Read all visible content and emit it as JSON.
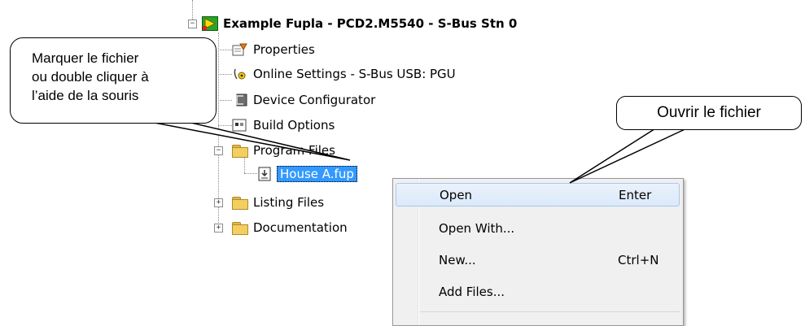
{
  "tree": {
    "root": "Example Fupla - PCD2.M5540 - S-Bus Stn 0",
    "items": [
      {
        "label": "Properties"
      },
      {
        "label": "Online Settings - S-Bus USB: PGU"
      },
      {
        "label": "Device Configurator"
      },
      {
        "label": "Build Options"
      },
      {
        "label": "Program Files"
      },
      {
        "label": "House A.fup"
      },
      {
        "label": "Listing Files"
      },
      {
        "label": "Documentation"
      }
    ]
  },
  "context_menu": {
    "items": [
      {
        "label": "Open",
        "shortcut": "Enter"
      },
      {
        "label": "Open With...",
        "shortcut": ""
      },
      {
        "label": "New...",
        "shortcut": "Ctrl+N"
      },
      {
        "label": "Add Files...",
        "shortcut": ""
      }
    ]
  },
  "callouts": {
    "left": [
      "Marquer le fichier",
      "ou double cliquer à",
      "l’aide de la souris"
    ],
    "right": "Ouvrir le fichier"
  },
  "colors": {
    "selection": "#3399ff",
    "folder": "#f3cf62",
    "menu_bg": "#f0f0f0"
  }
}
